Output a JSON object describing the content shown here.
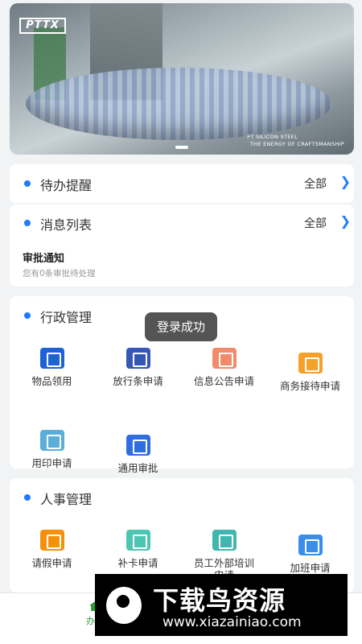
{
  "banner": {
    "logo": "PTTX",
    "tagline1": "PT SILICON STEEL",
    "tagline2": "THE ENERGY OF CRAFTSMANSHIP"
  },
  "todo": {
    "title": "待办提醒",
    "more": "全部"
  },
  "messages": {
    "title": "消息列表",
    "more": "全部",
    "notice_title": "审批通知",
    "notice_sub": "您有0条审批待处理"
  },
  "admin": {
    "title": "行政管理",
    "items": [
      {
        "label": "物品领用",
        "icon": "goods-icon",
        "color": "#1d63d6"
      },
      {
        "label": "放行条申请",
        "icon": "pass-icon",
        "color": "#3558b8"
      },
      {
        "label": "信息公告申请",
        "icon": "announcement-icon",
        "color": "#f08a6b"
      },
      {
        "label": "商务接待申请",
        "icon": "coffee-icon",
        "color": "#f5a02a"
      },
      {
        "label": "用印申请",
        "icon": "seal-icon",
        "color": "#5aaed8"
      },
      {
        "label": "通用审批",
        "icon": "approval-icon",
        "color": "#2f6ee0"
      }
    ]
  },
  "hr": {
    "title": "人事管理",
    "items": [
      {
        "label": "请假申请",
        "icon": "leave-icon",
        "color": "#f5900f"
      },
      {
        "label": "补卡申请",
        "icon": "calendar-icon",
        "color": "#4cc6b2"
      },
      {
        "label": "员工外部培训申请",
        "icon": "training-icon",
        "color": "#3fb7b0"
      },
      {
        "label": "加班申请",
        "icon": "overtime-icon",
        "color": "#3b8de8"
      }
    ]
  },
  "toast": "登录成功",
  "tabbar": {
    "home_label": "办公"
  },
  "watermark": {
    "title": "下载鸟资源",
    "url": "www.xiazainiao.com"
  }
}
